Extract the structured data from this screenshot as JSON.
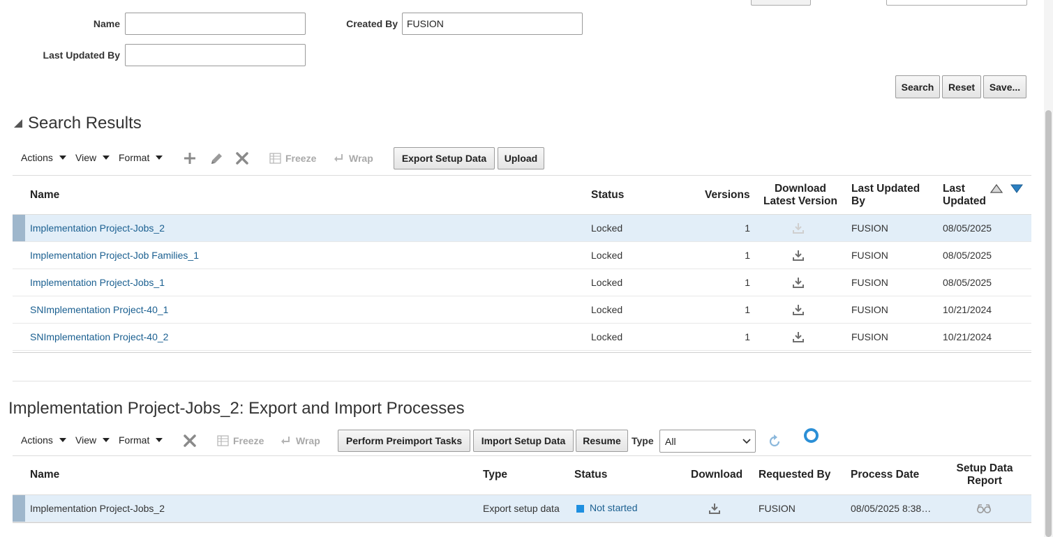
{
  "search_form": {
    "name_label": "Name",
    "name_value": "",
    "created_by_label": "Created By",
    "created_by_value": "FUSION",
    "last_updated_by_label": "Last Updated By",
    "last_updated_by_value": "",
    "search_button": "Search",
    "reset_button": "Reset",
    "save_button": "Save..."
  },
  "search_results": {
    "title": "Search Results",
    "toolbar": {
      "actions": "Actions",
      "view": "View",
      "format": "Format",
      "freeze": "Freeze",
      "wrap": "Wrap",
      "export_button": "Export Setup Data",
      "upload_button": "Upload"
    },
    "columns": {
      "name": "Name",
      "status": "Status",
      "versions": "Versions",
      "download_1": "Download",
      "download_2": "Latest Version",
      "updated_by_1": "Last Updated",
      "updated_by_2": "By",
      "updated_1": "Last",
      "updated_2": "Updated"
    },
    "rows": [
      {
        "name": "Implementation Project-Jobs_2",
        "status": "Locked",
        "versions": "1",
        "updated_by": "FUSION",
        "updated": "08/05/2025"
      },
      {
        "name": "Implementation Project-Job Families_1",
        "status": "Locked",
        "versions": "1",
        "updated_by": "FUSION",
        "updated": "08/05/2025"
      },
      {
        "name": "Implementation Project-Jobs_1",
        "status": "Locked",
        "versions": "1",
        "updated_by": "FUSION",
        "updated": "08/05/2025"
      },
      {
        "name": "SNImplementation Project-40_1",
        "status": "Locked",
        "versions": "1",
        "updated_by": "FUSION",
        "updated": "10/21/2024"
      },
      {
        "name": "SNImplementation Project-40_2",
        "status": "Locked",
        "versions": "1",
        "updated_by": "FUSION",
        "updated": "10/21/2024"
      }
    ]
  },
  "processes": {
    "title": "Implementation Project-Jobs_2: Export and Import Processes",
    "toolbar": {
      "actions": "Actions",
      "view": "View",
      "format": "Format",
      "freeze": "Freeze",
      "wrap": "Wrap",
      "preimport_button": "Perform Preimport Tasks",
      "import_button": "Import Setup Data",
      "resume_button": "Resume",
      "type_label": "Type",
      "type_value": "All"
    },
    "columns": {
      "name": "Name",
      "type": "Type",
      "status": "Status",
      "download": "Download",
      "requested_by": "Requested By",
      "process_date": "Process Date",
      "report_1": "Setup Data",
      "report_2": "Report"
    },
    "rows": [
      {
        "name": "Implementation Project-Jobs_2",
        "type": "Export setup data",
        "status": "Not started",
        "requested_by": "FUSION",
        "process_date": "08/05/2025 8:38…"
      }
    ]
  },
  "colors": {
    "link": "#1a5f90",
    "selected_row": "#e2eef8",
    "status_square": "#1e8fe0",
    "spinner": "#2b8fd6"
  }
}
